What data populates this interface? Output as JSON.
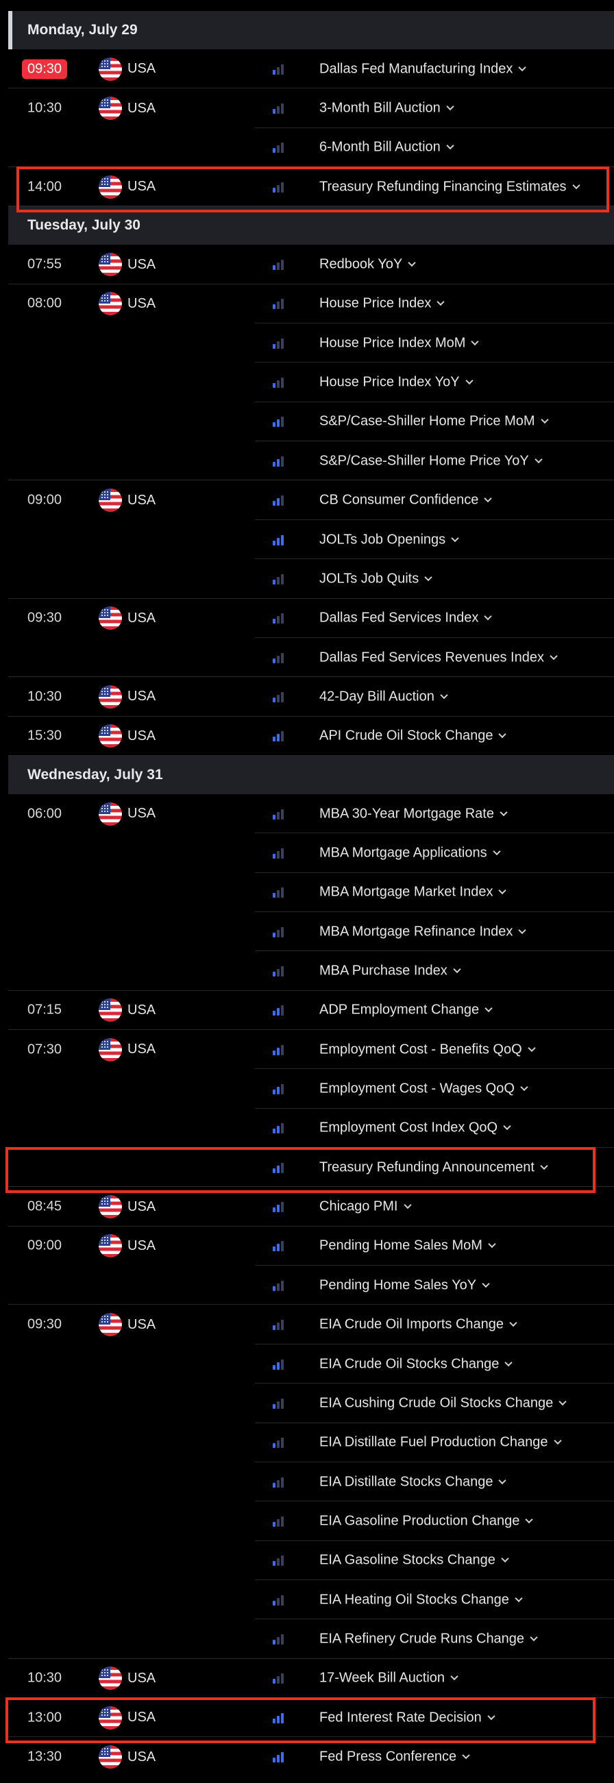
{
  "calendar": {
    "days": [
      {
        "label": "Monday, July 29",
        "active": true,
        "rows": [
          {
            "time": "09:30",
            "country": "USA",
            "impact": 1,
            "event": "Dallas Fed Manufacturing Index",
            "now": true
          },
          {
            "time": "10:30",
            "country": "USA",
            "impact": 1,
            "event": "3-Month Bill Auction"
          },
          {
            "time": "",
            "country": "",
            "impact": 1,
            "event": "6-Month Bill Auction"
          },
          {
            "time": "14:00",
            "country": "USA",
            "impact": 1,
            "event": "Treasury Refunding Financing Estimates",
            "highlight": true
          }
        ]
      },
      {
        "label": "Tuesday, July 30",
        "rows": [
          {
            "time": "07:55",
            "country": "USA",
            "impact": 1,
            "event": "Redbook YoY"
          },
          {
            "time": "08:00",
            "country": "USA",
            "impact": 1,
            "event": "House Price Index"
          },
          {
            "time": "",
            "country": "",
            "impact": 1,
            "event": "House Price Index MoM"
          },
          {
            "time": "",
            "country": "",
            "impact": 1,
            "event": "House Price Index YoY"
          },
          {
            "time": "",
            "country": "",
            "impact": 2,
            "event": "S&P/Case-Shiller Home Price MoM"
          },
          {
            "time": "",
            "country": "",
            "impact": 2,
            "event": "S&P/Case-Shiller Home Price YoY"
          },
          {
            "time": "09:00",
            "country": "USA",
            "impact": 2,
            "event": "CB Consumer Confidence"
          },
          {
            "time": "",
            "country": "",
            "impact": 3,
            "event": "JOLTs Job Openings"
          },
          {
            "time": "",
            "country": "",
            "impact": 1,
            "event": "JOLTs Job Quits"
          },
          {
            "time": "09:30",
            "country": "USA",
            "impact": 1,
            "event": "Dallas Fed Services Index"
          },
          {
            "time": "",
            "country": "",
            "impact": 1,
            "event": "Dallas Fed Services Revenues Index"
          },
          {
            "time": "10:30",
            "country": "USA",
            "impact": 1,
            "event": "42-Day Bill Auction"
          },
          {
            "time": "15:30",
            "country": "USA",
            "impact": 2,
            "event": "API Crude Oil Stock Change"
          }
        ]
      },
      {
        "label": "Wednesday, July 31",
        "rows": [
          {
            "time": "06:00",
            "country": "USA",
            "impact": 1,
            "event": "MBA 30-Year Mortgage Rate"
          },
          {
            "time": "",
            "country": "",
            "impact": 1,
            "event": "MBA Mortgage Applications"
          },
          {
            "time": "",
            "country": "",
            "impact": 1,
            "event": "MBA Mortgage Market Index"
          },
          {
            "time": "",
            "country": "",
            "impact": 1,
            "event": "MBA Mortgage Refinance Index"
          },
          {
            "time": "",
            "country": "",
            "impact": 1,
            "event": "MBA Purchase Index"
          },
          {
            "time": "07:15",
            "country": "USA",
            "impact": 2,
            "event": "ADP Employment Change"
          },
          {
            "time": "07:30",
            "country": "USA",
            "impact": 2,
            "event": "Employment Cost - Benefits QoQ"
          },
          {
            "time": "",
            "country": "",
            "impact": 2,
            "event": "Employment Cost - Wages QoQ"
          },
          {
            "time": "",
            "country": "",
            "impact": 2,
            "event": "Employment Cost Index QoQ"
          },
          {
            "time": "",
            "country": "",
            "impact": 2,
            "event": "Treasury Refunding Announcement",
            "highlight": true
          },
          {
            "time": "08:45",
            "country": "USA",
            "impact": 2,
            "event": "Chicago PMI"
          },
          {
            "time": "09:00",
            "country": "USA",
            "impact": 2,
            "event": "Pending Home Sales MoM"
          },
          {
            "time": "",
            "country": "",
            "impact": 1,
            "event": "Pending Home Sales YoY"
          },
          {
            "time": "09:30",
            "country": "USA",
            "impact": 1,
            "event": "EIA Crude Oil Imports Change"
          },
          {
            "time": "",
            "country": "",
            "impact": 2,
            "event": "EIA Crude Oil Stocks Change"
          },
          {
            "time": "",
            "country": "",
            "impact": 1,
            "event": "EIA Cushing Crude Oil Stocks Change"
          },
          {
            "time": "",
            "country": "",
            "impact": 1,
            "event": "EIA Distillate Fuel Production Change"
          },
          {
            "time": "",
            "country": "",
            "impact": 1,
            "event": "EIA Distillate Stocks Change"
          },
          {
            "time": "",
            "country": "",
            "impact": 1,
            "event": "EIA Gasoline Production Change"
          },
          {
            "time": "",
            "country": "",
            "impact": 1,
            "event": "EIA Gasoline Stocks Change"
          },
          {
            "time": "",
            "country": "",
            "impact": 1,
            "event": "EIA Heating Oil Stocks Change"
          },
          {
            "time": "",
            "country": "",
            "impact": 1,
            "event": "EIA Refinery Crude Runs Change"
          },
          {
            "time": "10:30",
            "country": "USA",
            "impact": 1,
            "event": "17-Week Bill Auction"
          },
          {
            "time": "13:00",
            "country": "USA",
            "impact": 3,
            "event": "Fed Interest Rate Decision",
            "highlight": true
          },
          {
            "time": "13:30",
            "country": "USA",
            "impact": 3,
            "event": "Fed Press Conference",
            "last": true
          }
        ]
      }
    ]
  },
  "colors": {
    "background": "#000000",
    "header_bg": "#1f2127",
    "now_badge": "#f0303c",
    "impact_active": "#3b6df2",
    "impact_inactive": "#3a3f5a",
    "highlight_border": "#e8311f"
  },
  "icons": {
    "flag": "usa-flag-icon",
    "impact": "impact-bars-icon",
    "expand": "chevron-down-icon"
  }
}
